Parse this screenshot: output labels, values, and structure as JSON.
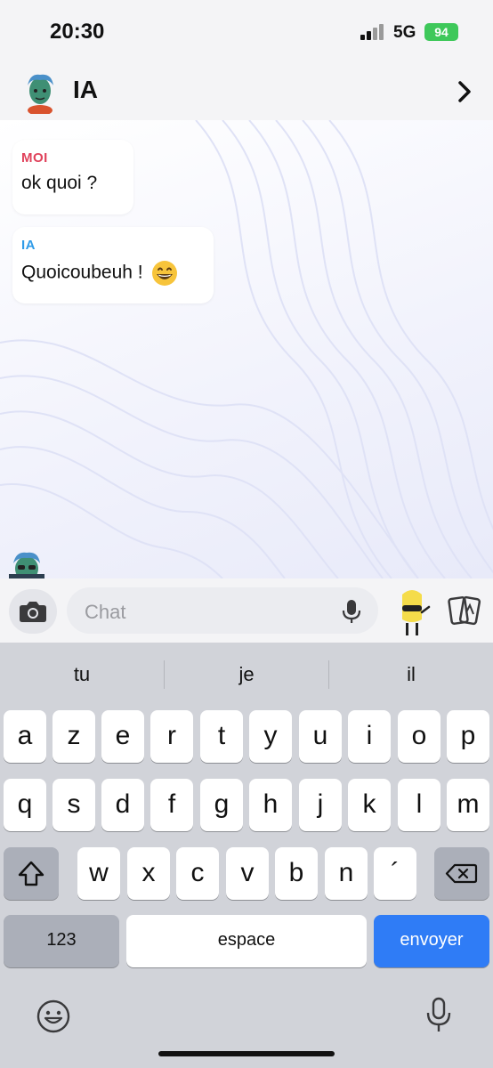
{
  "status_bar": {
    "time": "20:30",
    "network": "5G",
    "battery": "94"
  },
  "header": {
    "title": "IA",
    "avatar_icon": "bitmoji-avatar-icon",
    "chevron_icon": "chevron-right-icon"
  },
  "messages": [
    {
      "sender": "MOI",
      "text": "ok quoi ?",
      "sender_color": "#e0425b"
    },
    {
      "sender": "IA",
      "text": "Quoicoubeuh !",
      "emoji": "grinning-face-emoji",
      "sender_color": "#2f9be8"
    }
  ],
  "input_bar": {
    "placeholder": "Chat",
    "camera_icon": "camera-icon",
    "mic_icon": "microphone-icon",
    "bitmoji_icon": "bitmoji-icon",
    "cards_icon": "cards-icon"
  },
  "keyboard": {
    "suggestions": [
      "tu",
      "je",
      "il"
    ],
    "row1": [
      "a",
      "z",
      "e",
      "r",
      "t",
      "y",
      "u",
      "i",
      "o",
      "p"
    ],
    "row2": [
      "q",
      "s",
      "d",
      "f",
      "g",
      "h",
      "j",
      "k",
      "l",
      "m"
    ],
    "row3": [
      "w",
      "x",
      "c",
      "v",
      "b",
      "n",
      "´"
    ],
    "numbers_label": "123",
    "space_label": "espace",
    "return_label": "envoyer",
    "accent_color": "#2f7cf6"
  }
}
